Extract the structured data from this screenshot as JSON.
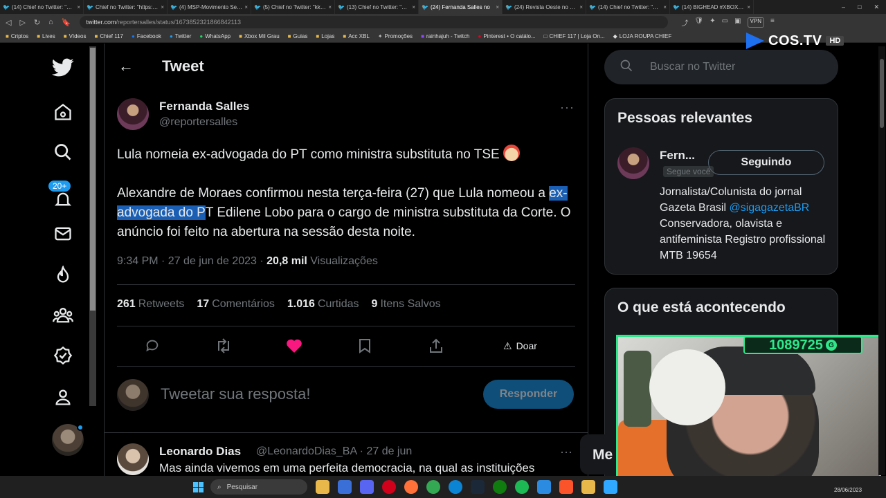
{
  "browser": {
    "tabs": [
      {
        "label": "(14) Chief no Twitter: \"O ca",
        "active": false
      },
      {
        "label": "Chief no Twitter: \"https://t.c",
        "active": false
      },
      {
        "label": "(4) MSP-Movimento Sem P",
        "active": false
      },
      {
        "label": "(5) Chief no Twitter: \"kkkkk",
        "active": false
      },
      {
        "label": "(13) Chief no Twitter: \"KKK",
        "active": false
      },
      {
        "label": "(24) Fernanda Salles no",
        "active": true
      },
      {
        "label": "(24) Revista Oeste no Twitt",
        "active": false
      },
      {
        "label": "(14) Chief no Twitter: \"Fina",
        "active": false
      },
      {
        "label": "(14) BIGHEAD #XBOX no Tw",
        "active": false
      }
    ],
    "url_host": "twitter.com",
    "url_path": "/reportersalles/status/1673852321866842113",
    "vpn_label": "VPN",
    "bookmarks": [
      "Criptos",
      "Lives",
      "Vídeos",
      "Chief 117",
      "Facebook",
      "Twitter",
      "WhatsApp",
      "Xbox Mil Grau",
      "Guias",
      "Lojas",
      "Acc XBL",
      "Promoções",
      "rainhajuh - Twitch",
      "Pinterest • O catálo...",
      "CHIEF 117 | Loja On...",
      "LOJA ROUPA CHIEF"
    ]
  },
  "overlay": {
    "brand": "COS.TV",
    "hd": "HD",
    "counter": "1089725",
    "counter_icon": "G",
    "men_label": "Me"
  },
  "sidebar": {
    "badge": "20+"
  },
  "tweet_header": {
    "back": "←",
    "title": "Tweet"
  },
  "tweet": {
    "author_name": "Fernanda Salles",
    "author_handle": "@reportersalles",
    "more": "···",
    "line1": "Lula nomeia ex-advogada do PT como ministra substituta no TSE",
    "para2_a": "Alexandre de Moraes confirmou nesta terça-feira (27) que Lula nomeou a ",
    "para2_highlight": "ex-advogada do P",
    "para2_b": "T Edilene Lobo para o cargo de ministra substituta da Corte. O anúncio foi feito na abertura na sessão desta noite.",
    "time": "9:34 PM · 27 de jun de 2023 · ",
    "views_count": "20,8 mil",
    "views_label": "Visualizações",
    "stats": [
      {
        "count": "261",
        "label": "Retweets"
      },
      {
        "count": "17",
        "label": "Comentários"
      },
      {
        "count": "1.016",
        "label": "Curtidas"
      },
      {
        "count": "9",
        "label": "Itens Salvos"
      }
    ],
    "donate_label": "Doar"
  },
  "reply": {
    "placeholder": "Tweetar sua resposta!",
    "button": "Responder"
  },
  "reply_tweet": {
    "name": "Leonardo Dias",
    "handle": "@LeonardoDias_BA · 27 de jun",
    "more": "···",
    "text": "Mas ainda vivemos em uma perfeita democracia, na qual as instituições"
  },
  "right": {
    "search_placeholder": "Buscar no Twitter",
    "relevant_title": "Pessoas relevantes",
    "person_name": "Fern...",
    "person_follows": "Segue você",
    "person_button": "Seguindo",
    "bio_a": "Jornalista/Colunista do jornal Gazeta Brasil ",
    "bio_link": "@sigagazetaBR",
    "bio_b": " Conservadora, olavista e antifeminista Registro profissional MTB 19654",
    "trending_title": "O que está acontecendo"
  },
  "taskbar": {
    "search": "Pesquisar",
    "date": "28/06/2023"
  }
}
